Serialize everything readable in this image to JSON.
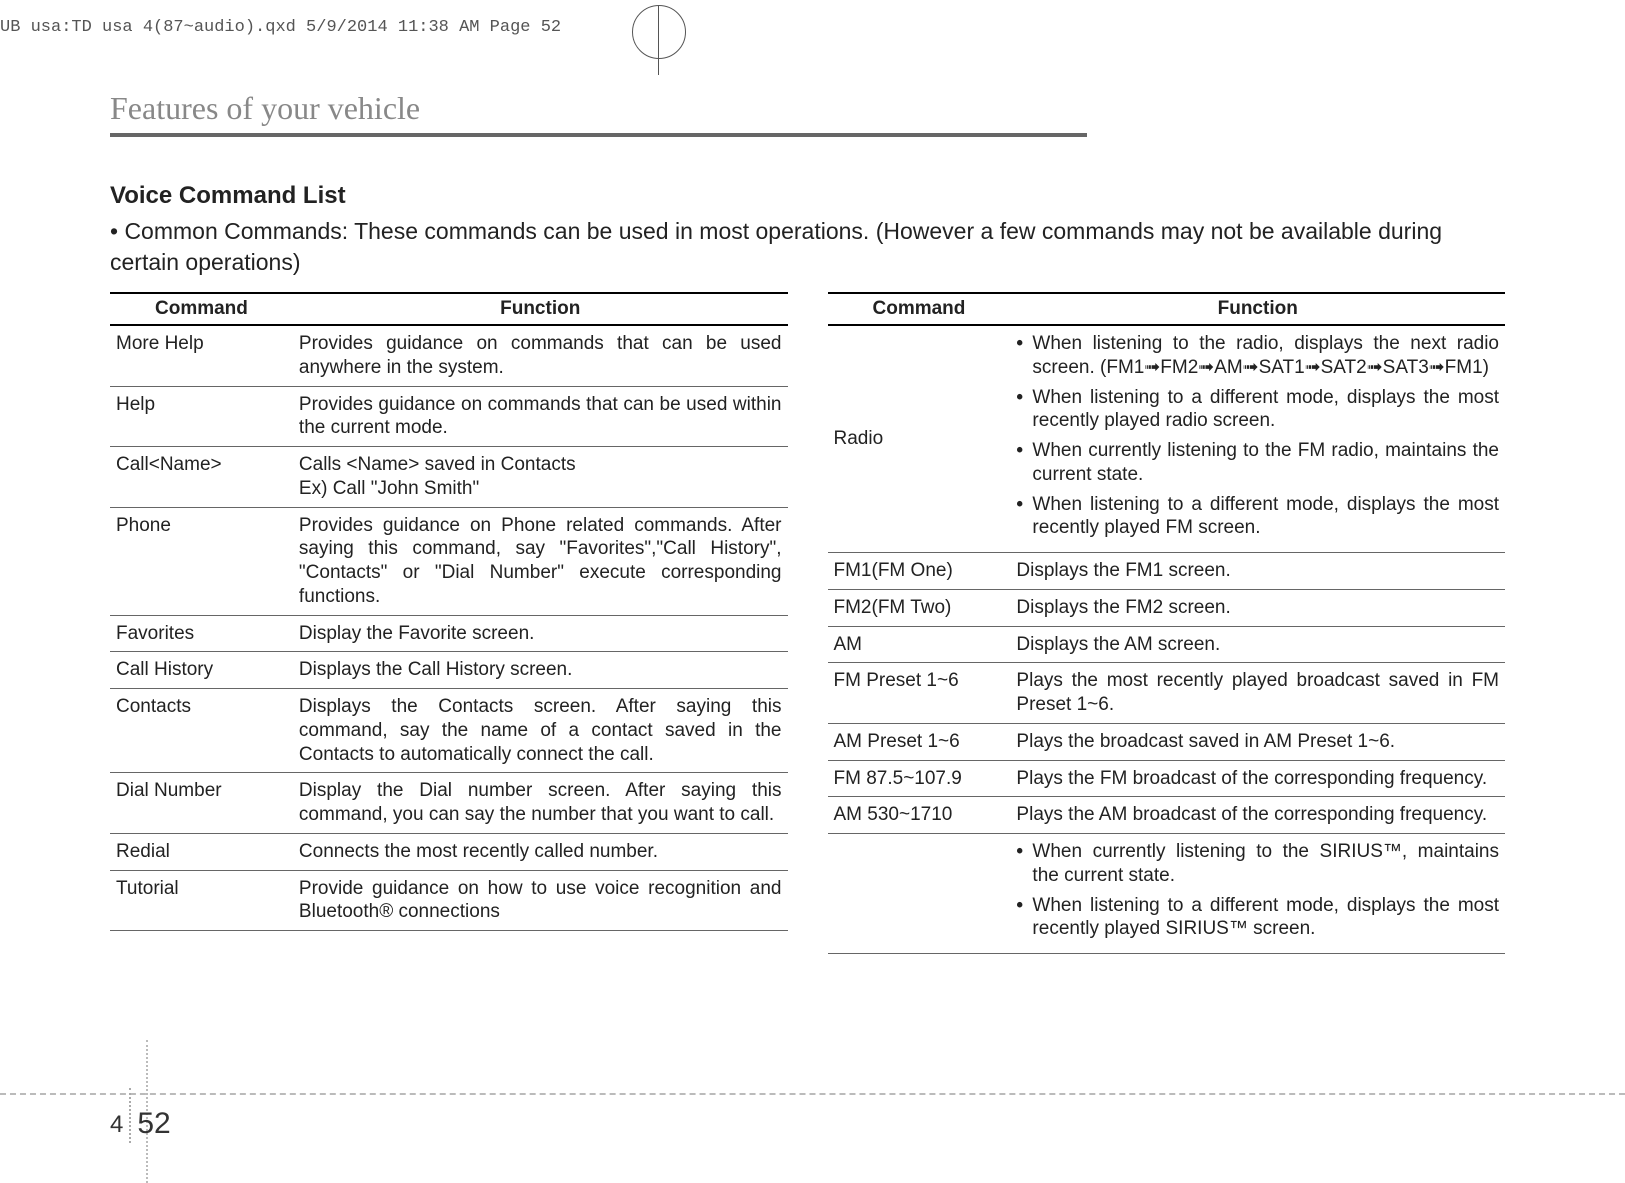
{
  "meta": {
    "headerText": "UB usa:TD usa 4(87~audio).qxd  5/9/2014  11:38 AM  Page 52",
    "chapter": "Features of your vehicle",
    "sectionTitle": "Voice Command List",
    "intro": "• Common Commands: These commands can be used in most operations. (However a few commands may not be available during certain operations)",
    "pageSmall": "4",
    "pageBig": "52"
  },
  "headers": {
    "command": "Command",
    "function": "Function"
  },
  "left_rows": [
    {
      "c": "More Help",
      "f": "Provides guidance on commands that can be used anywhere in the system."
    },
    {
      "c": "Help",
      "f": "Provides guidance on commands that can be used within the current mode."
    },
    {
      "c": "Call<Name>",
      "f": "Calls <Name> saved in Contacts\nEx) Call \"John Smith\""
    },
    {
      "c": "Phone",
      "f": "Provides guidance on Phone related commands. After saying this command, say \"Favorites\",\"Call History\", \"Contacts\" or \"Dial Number\" execute corresponding functions."
    },
    {
      "c": "Favorites",
      "f": "Display the Favorite screen."
    },
    {
      "c": "Call History",
      "f": "Displays the Call History screen."
    },
    {
      "c": "Contacts",
      "f": "Displays the Contacts screen. After saying this command, say the name of a contact saved in the Contacts to automatically connect the call."
    },
    {
      "c": "Dial Number",
      "f": "Display the Dial number screen. After saying this command, you can say the number  that you want to call."
    },
    {
      "c": "Redial",
      "f": "Connects the most recently called number."
    },
    {
      "c": "Tutorial",
      "f": "Provide guidance on how to use voice recognition and Bluetooth® connections"
    }
  ],
  "right_rows": [
    {
      "c": "Radio",
      "bullets": [
        "When listening to the radio, displays the next radio screen. (FM1➟FM2➟AM➟SAT1➟SAT2➟SAT3➟FM1)",
        "When listening to a different mode, displays the most recently played radio screen.",
        "When currently listening to the FM radio, maintains the current state.",
        "When listening to a different mode, displays the most recently played FM screen."
      ]
    },
    {
      "c": "FM1(FM One)",
      "f": "Displays the FM1 screen."
    },
    {
      "c": "FM2(FM Two)",
      "f": "Displays the FM2 screen."
    },
    {
      "c": "AM",
      "f": "Displays the AM screen."
    },
    {
      "c": "FM Preset 1~6",
      "f": "Plays the most recently played broadcast saved in FM Preset 1~6."
    },
    {
      "c": "AM Preset 1~6",
      "f": "Plays the broadcast saved in AM Preset 1~6."
    },
    {
      "c": "FM 87.5~107.9",
      "f": "Plays the FM broadcast of the corresponding frequency."
    },
    {
      "c": "AM 530~1710",
      "f": "Plays the AM broadcast of the corresponding frequency."
    },
    {
      "c": "",
      "bullets": [
        "When currently listening to the SIRIUS™, maintains the current state.",
        "When listening to a different mode, displays the most recently played SIRIUS™ screen."
      ]
    }
  ]
}
